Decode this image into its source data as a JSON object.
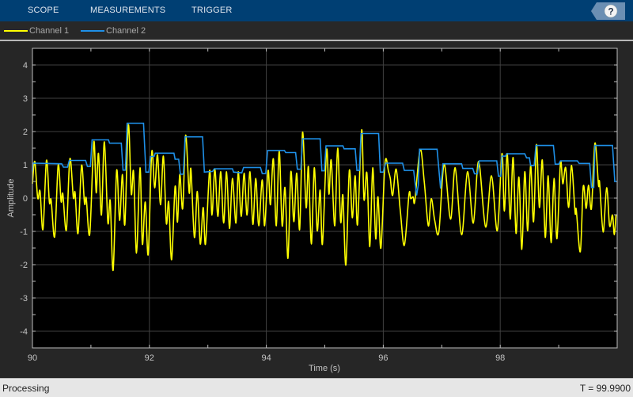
{
  "toolbar": {
    "tabs": [
      "SCOPE",
      "MEASUREMENTS",
      "TRIGGER"
    ],
    "help_icon": "question-mark-icon",
    "bg_color": "#003f73"
  },
  "legend": {
    "items": [
      {
        "label": "Channel 1",
        "color": "#ffff00"
      },
      {
        "label": "Channel 2",
        "color": "#1e90e8"
      }
    ]
  },
  "status": {
    "left": "Processing",
    "right": "T = 99.9900"
  },
  "chart_data": {
    "type": "line",
    "title": "",
    "xlabel": "Time (s)",
    "ylabel": "Amplitude",
    "xlim": [
      90,
      100
    ],
    "ylim": [
      -4.5,
      4.5
    ],
    "xticks": [
      90,
      92,
      94,
      96,
      98
    ],
    "yticks": [
      4,
      3,
      2,
      1,
      0,
      -1,
      -2,
      -3,
      -4
    ],
    "grid": true,
    "legend_placement": "top-left-outside",
    "series": [
      {
        "name": "Channel 1",
        "color": "#ffff00",
        "points": [
          [
            90.0,
            0.43
          ],
          [
            90.04,
            1.1
          ],
          [
            90.09,
            0.0
          ],
          [
            90.13,
            0.21
          ],
          [
            90.18,
            -0.94
          ],
          [
            90.24,
            1.13
          ],
          [
            90.29,
            -0.12
          ],
          [
            90.32,
            -0.06
          ],
          [
            90.38,
            -1.16
          ],
          [
            90.44,
            0.99
          ],
          [
            90.49,
            -0.1
          ],
          [
            90.52,
            0.13
          ],
          [
            90.58,
            -0.96
          ],
          [
            90.64,
            1.18
          ],
          [
            90.7,
            0.02
          ],
          [
            90.73,
            0.16
          ],
          [
            90.78,
            -1.06
          ],
          [
            90.84,
            0.98
          ],
          [
            90.89,
            -0.16
          ],
          [
            90.92,
            0.0
          ],
          [
            90.98,
            -1.08
          ],
          [
            91.05,
            1.69
          ],
          [
            91.09,
            0.16
          ],
          [
            91.13,
            1.34
          ],
          [
            91.18,
            -0.51
          ],
          [
            91.23,
            1.69
          ],
          [
            91.29,
            -0.73
          ],
          [
            91.33,
            -0.08
          ],
          [
            91.38,
            -2.17
          ],
          [
            91.44,
            0.83
          ],
          [
            91.49,
            -0.67
          ],
          [
            91.54,
            0.71
          ],
          [
            91.58,
            -0.79
          ],
          [
            91.64,
            2.2
          ],
          [
            91.69,
            0.13
          ],
          [
            91.73,
            0.79
          ],
          [
            91.78,
            -1.65
          ],
          [
            91.84,
            0.91
          ],
          [
            91.88,
            -1.38
          ],
          [
            91.93,
            -0.12
          ],
          [
            91.98,
            -1.69
          ],
          [
            92.04,
            1.38
          ],
          [
            92.09,
            0.31
          ],
          [
            92.14,
            1.3
          ],
          [
            92.19,
            -0.2
          ],
          [
            92.24,
            1.26
          ],
          [
            92.29,
            -0.75
          ],
          [
            92.33,
            -0.12
          ],
          [
            92.38,
            -1.85
          ],
          [
            92.44,
            0.35
          ],
          [
            92.48,
            -0.72
          ],
          [
            92.52,
            0.71
          ],
          [
            92.57,
            -0.31
          ],
          [
            92.62,
            1.89
          ],
          [
            92.68,
            0.16
          ],
          [
            92.71,
            0.87
          ],
          [
            92.77,
            -1.18
          ],
          [
            92.82,
            0.2
          ],
          [
            92.87,
            -1.38
          ],
          [
            92.92,
            -0.28
          ],
          [
            92.96,
            -1.38
          ],
          [
            93.03,
            0.83
          ],
          [
            93.07,
            -0.51
          ],
          [
            93.12,
            0.87
          ],
          [
            93.17,
            -0.55
          ],
          [
            93.22,
            0.79
          ],
          [
            93.27,
            -0.75
          ],
          [
            93.32,
            0.79
          ],
          [
            93.37,
            -0.91
          ],
          [
            93.42,
            0.59
          ],
          [
            93.48,
            -0.75
          ],
          [
            93.52,
            0.79
          ],
          [
            93.57,
            -0.55
          ],
          [
            93.62,
            0.75
          ],
          [
            93.67,
            -0.51
          ],
          [
            93.72,
            0.79
          ],
          [
            93.77,
            -0.79
          ],
          [
            93.82,
            0.59
          ],
          [
            93.87,
            -0.83
          ],
          [
            93.93,
            0.55
          ],
          [
            93.97,
            -0.83
          ],
          [
            94.03,
            0.83
          ],
          [
            94.07,
            -0.2
          ],
          [
            94.12,
            1.18
          ],
          [
            94.17,
            -0.83
          ],
          [
            94.22,
            1.42
          ],
          [
            94.27,
            -0.83
          ],
          [
            94.32,
            0.31
          ],
          [
            94.37,
            -1.81
          ],
          [
            94.42,
            0.79
          ],
          [
            94.47,
            -0.71
          ],
          [
            94.52,
            0.75
          ],
          [
            94.57,
            -0.94
          ],
          [
            94.62,
            1.98
          ],
          [
            94.68,
            -0.28
          ],
          [
            94.72,
            0.94
          ],
          [
            94.77,
            -1.38
          ],
          [
            94.82,
            0.91
          ],
          [
            94.87,
            -0.98
          ],
          [
            94.92,
            0.24
          ],
          [
            94.96,
            -1.38
          ],
          [
            95.03,
            1.45
          ],
          [
            95.07,
            0.12
          ],
          [
            95.11,
            1.14
          ],
          [
            95.17,
            -0.83
          ],
          [
            95.22,
            1.5
          ],
          [
            95.27,
            -0.71
          ],
          [
            95.31,
            0.08
          ],
          [
            95.36,
            -2.01
          ],
          [
            95.42,
            0.83
          ],
          [
            95.47,
            -0.59
          ],
          [
            95.52,
            0.67
          ],
          [
            95.56,
            -0.79
          ],
          [
            95.63,
            2.05
          ],
          [
            95.67,
            -0.04
          ],
          [
            95.72,
            0.75
          ],
          [
            95.77,
            -1.46
          ],
          [
            95.82,
            0.91
          ],
          [
            95.87,
            -1.22
          ],
          [
            95.91,
            0.04
          ],
          [
            95.96,
            -1.5
          ],
          [
            96.03,
            1.06
          ],
          [
            96.09,
            0.79
          ],
          [
            96.12,
            0.59
          ],
          [
            96.16,
            0.08
          ],
          [
            96.22,
            0.87
          ],
          [
            96.29,
            -0.35
          ],
          [
            96.36,
            -1.42
          ],
          [
            96.44,
            0.12
          ],
          [
            96.47,
            -0.02
          ],
          [
            96.51,
            0.04
          ],
          [
            96.54,
            -0.08
          ],
          [
            96.63,
            1.46
          ],
          [
            96.7,
            0.51
          ],
          [
            96.77,
            -0.83
          ],
          [
            96.82,
            -0.02
          ],
          [
            96.88,
            -0.67
          ],
          [
            96.95,
            -1.02
          ],
          [
            97.04,
            1.02
          ],
          [
            97.15,
            -0.63
          ],
          [
            97.23,
            0.91
          ],
          [
            97.34,
            -1.1
          ],
          [
            97.44,
            0.79
          ],
          [
            97.54,
            -0.75
          ],
          [
            97.63,
            1.1
          ],
          [
            97.75,
            -0.87
          ],
          [
            97.85,
            0.67
          ],
          [
            97.95,
            -0.98
          ],
          [
            98.03,
            1.34
          ],
          [
            98.07,
            -0.39
          ],
          [
            98.12,
            1.34
          ],
          [
            98.17,
            -0.63
          ],
          [
            98.22,
            1.22
          ],
          [
            98.27,
            -1.06
          ],
          [
            98.32,
            0.63
          ],
          [
            98.37,
            -1.54
          ],
          [
            98.42,
            0.79
          ],
          [
            98.47,
            -0.98
          ],
          [
            98.52,
            0.98
          ],
          [
            98.57,
            -0.71
          ],
          [
            98.62,
            1.61
          ],
          [
            98.67,
            -0.28
          ],
          [
            98.72,
            1.14
          ],
          [
            98.77,
            -1.18
          ],
          [
            98.82,
            0.67
          ],
          [
            98.87,
            -1.34
          ],
          [
            98.92,
            0.59
          ],
          [
            98.97,
            -1.22
          ],
          [
            99.03,
            1.06
          ],
          [
            99.07,
            0.43
          ],
          [
            99.12,
            0.91
          ],
          [
            99.17,
            -0.28
          ],
          [
            99.22,
            0.98
          ],
          [
            99.28,
            -0.43
          ],
          [
            99.3,
            -0.35
          ],
          [
            99.37,
            -1.61
          ],
          [
            99.42,
            0.35
          ],
          [
            99.47,
            -0.31
          ],
          [
            99.51,
            0.39
          ],
          [
            99.56,
            -0.31
          ],
          [
            99.62,
            1.65
          ],
          [
            99.68,
            0.39
          ],
          [
            99.7,
            0.47
          ],
          [
            99.76,
            -1.02
          ],
          [
            99.82,
            0.31
          ],
          [
            99.87,
            -0.83
          ],
          [
            99.92,
            -0.51
          ],
          [
            99.95,
            -1.1
          ],
          [
            99.98,
            -0.51
          ]
        ]
      },
      {
        "name": "Channel 2",
        "color": "#1e90e8",
        "points": [
          [
            90,
            0.8
          ],
          [
            90.01,
            1.05
          ],
          [
            90.5,
            1.03
          ],
          [
            90.53,
            0.93
          ],
          [
            90.6,
            0.93
          ],
          [
            90.63,
            1.13
          ],
          [
            90.91,
            1.13
          ],
          [
            90.94,
            0.95
          ],
          [
            90.99,
            0.95
          ],
          [
            91.02,
            1.75
          ],
          [
            91.3,
            1.75
          ],
          [
            91.32,
            1.65
          ],
          [
            91.52,
            1.65
          ],
          [
            91.55,
            0.84
          ],
          [
            91.59,
            0.84
          ],
          [
            91.62,
            2.25
          ],
          [
            91.9,
            2.25
          ],
          [
            91.94,
            0.78
          ],
          [
            91.99,
            0.78
          ],
          [
            92.02,
            1.25
          ],
          [
            92.08,
            1.25
          ],
          [
            92.1,
            1.35
          ],
          [
            92.42,
            1.35
          ],
          [
            92.44,
            1.17
          ],
          [
            92.5,
            1.17
          ],
          [
            92.53,
            0.72
          ],
          [
            92.58,
            0.72
          ],
          [
            92.61,
            1.84
          ],
          [
            92.91,
            1.84
          ],
          [
            92.94,
            0.78
          ],
          [
            93.08,
            0.8
          ],
          [
            93.11,
            0.88
          ],
          [
            93.42,
            0.88
          ],
          [
            93.44,
            0.78
          ],
          [
            93.58,
            0.76
          ],
          [
            93.61,
            0.92
          ],
          [
            93.9,
            0.92
          ],
          [
            93.93,
            0.74
          ],
          [
            93.99,
            0.74
          ],
          [
            94.02,
            1.43
          ],
          [
            94.31,
            1.43
          ],
          [
            94.33,
            1.37
          ],
          [
            94.5,
            1.37
          ],
          [
            94.53,
            0.87
          ],
          [
            94.59,
            0.87
          ],
          [
            94.62,
            1.78
          ],
          [
            94.92,
            1.78
          ],
          [
            94.95,
            0.82
          ],
          [
            94.99,
            0.82
          ],
          [
            95.02,
            1.57
          ],
          [
            95.31,
            1.57
          ],
          [
            95.33,
            1.48
          ],
          [
            95.52,
            1.48
          ],
          [
            95.55,
            0.83
          ],
          [
            95.59,
            0.83
          ],
          [
            95.62,
            1.94
          ],
          [
            95.92,
            1.94
          ],
          [
            95.95,
            0.78
          ],
          [
            96.0,
            0.78
          ],
          [
            96.04,
            1.05
          ],
          [
            96.33,
            1.05
          ],
          [
            96.36,
            0.83
          ],
          [
            96.52,
            0.83
          ],
          [
            96.57,
            0.08
          ],
          [
            96.6,
            0.4
          ],
          [
            96.62,
            1.47
          ],
          [
            96.92,
            1.47
          ],
          [
            96.98,
            0.29
          ],
          [
            97.02,
            1.03
          ],
          [
            97.34,
            1.03
          ],
          [
            97.36,
            0.89
          ],
          [
            97.53,
            0.89
          ],
          [
            97.56,
            0.73
          ],
          [
            97.61,
            0.73
          ],
          [
            97.64,
            1.12
          ],
          [
            97.94,
            1.12
          ],
          [
            97.97,
            0.66
          ],
          [
            98.01,
            0.66
          ],
          [
            98.03,
            1.26
          ],
          [
            98.09,
            1.26
          ],
          [
            98.11,
            1.33
          ],
          [
            98.42,
            1.33
          ],
          [
            98.45,
            1.21
          ],
          [
            98.5,
            1.21
          ],
          [
            98.52,
            0.98
          ],
          [
            98.58,
            0.98
          ],
          [
            98.61,
            1.58
          ],
          [
            98.91,
            1.58
          ],
          [
            98.94,
            1.02
          ],
          [
            99.0,
            1.02
          ],
          [
            99.03,
            1.12
          ],
          [
            99.32,
            1.12
          ],
          [
            99.35,
            1.04
          ],
          [
            99.53,
            1.04
          ],
          [
            99.56,
            0.32
          ],
          [
            99.6,
            0.32
          ],
          [
            99.62,
            1.58
          ],
          [
            99.92,
            1.58
          ],
          [
            99.96,
            0.5
          ],
          [
            99.99,
            0.5
          ]
        ]
      }
    ]
  }
}
